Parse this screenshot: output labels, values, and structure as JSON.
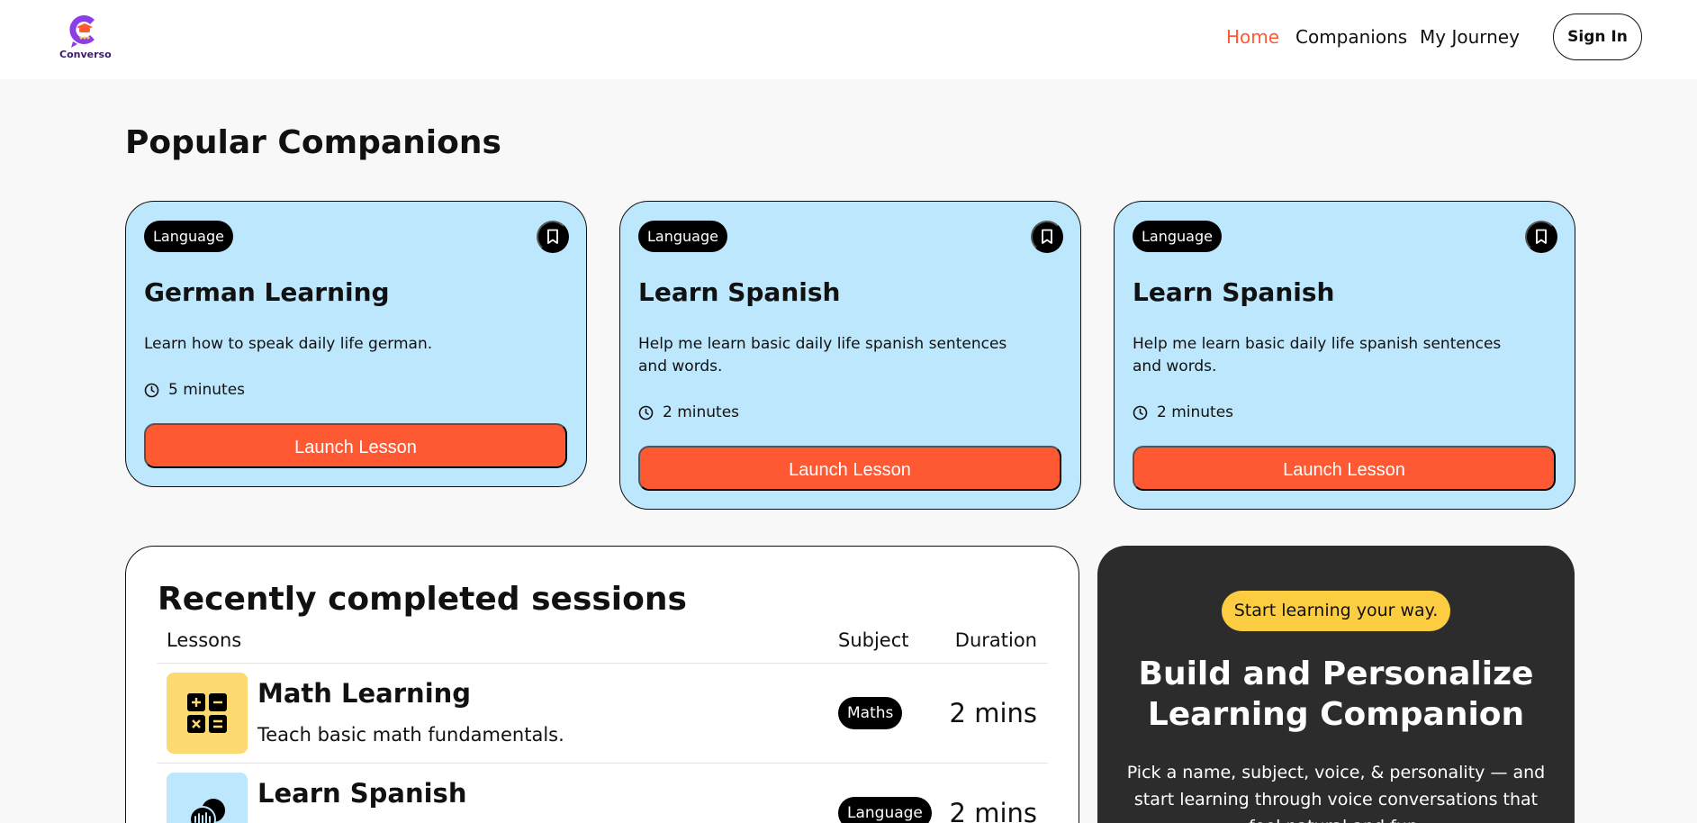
{
  "app": {
    "logo_text": "Converso"
  },
  "nav": {
    "links": [
      {
        "label": "Home",
        "active": true
      },
      {
        "label": "Companions",
        "active": false
      },
      {
        "label": "My Journey",
        "active": false
      }
    ],
    "signin_label": "Sign In"
  },
  "popular": {
    "title": "Popular Companions",
    "cards": [
      {
        "subject": "Language",
        "title": "German Learning",
        "description": "Learn how to speak daily life german.",
        "duration": "5 minutes",
        "button": "Launch Lesson"
      },
      {
        "subject": "Language",
        "title": "Learn Spanish",
        "description": "Help me learn basic daily life spanish sentences and words.",
        "duration": "2 minutes",
        "button": "Launch Lesson"
      },
      {
        "subject": "Language",
        "title": "Learn Spanish",
        "description": "Help me learn basic daily life spanish sentences and words.",
        "duration": "2 minutes",
        "button": "Launch Lesson"
      }
    ]
  },
  "sessions": {
    "title": "Recently completed sessions",
    "headers": {
      "lessons": "Lessons",
      "subject": "Subject",
      "duration": "Duration"
    },
    "rows": [
      {
        "name": "Math Learning",
        "description": "Teach basic math fundamentals.",
        "subject": "Maths",
        "duration": "2 mins",
        "icon": "calculator-icon"
      },
      {
        "name": "Learn Spanish",
        "description": "",
        "subject": "Language",
        "duration": "2 mins",
        "icon": "language-voice-icon"
      }
    ]
  },
  "cta": {
    "pill": "Start learning your way.",
    "title": "Build and Personalize Learning Companion",
    "description": "Pick a name, subject, voice, & personality — and start learning through voice conversations that feel natural and fun."
  },
  "colors": {
    "accent": "#fe5933",
    "card_bg": "#bde7fc",
    "cta_bg": "#2c2c2c",
    "pill_yellow": "#fccc41",
    "maths_icon_bg": "#fdd971",
    "language_icon_bg": "#bde7fc",
    "logo_purple": "#8b3ee8"
  }
}
